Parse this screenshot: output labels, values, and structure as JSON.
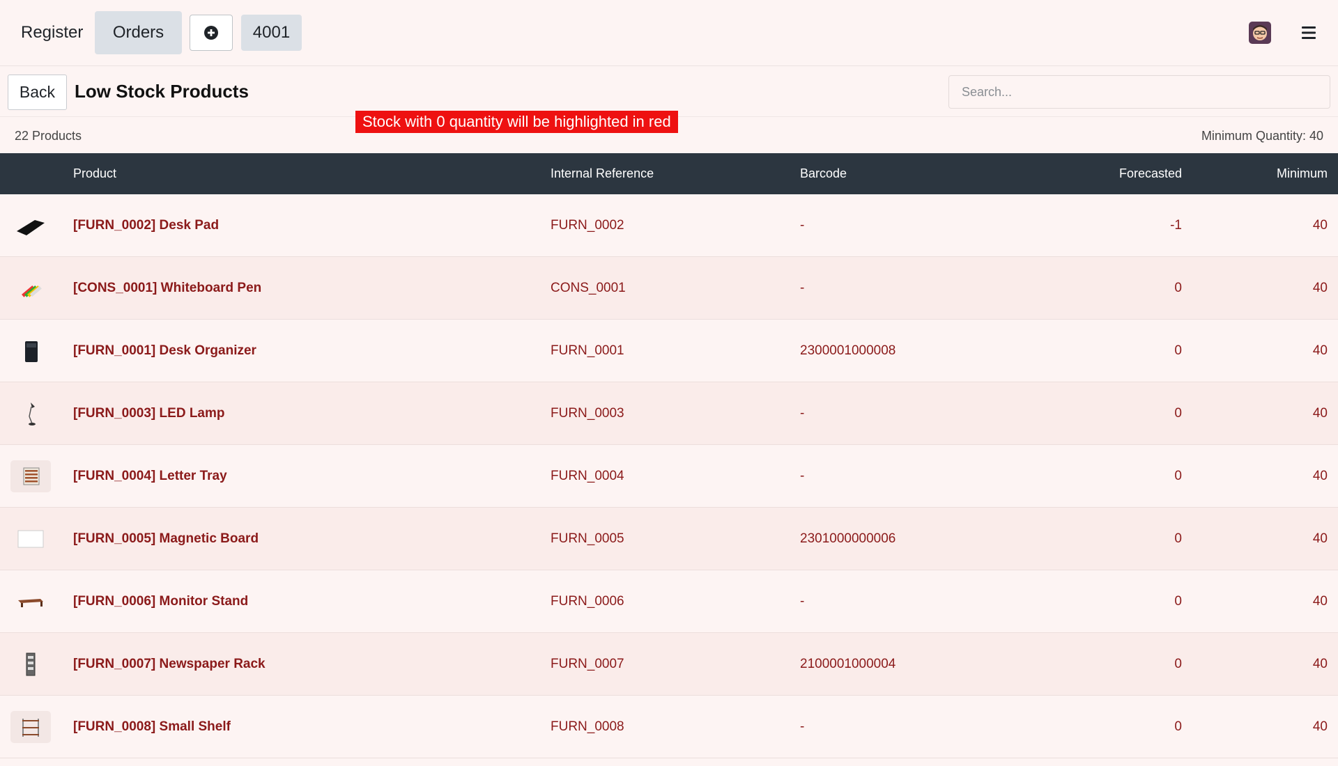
{
  "navbar": {
    "register_label": "Register",
    "orders_label": "Orders",
    "add_icon": "plus-circle-icon",
    "order_number": "4001",
    "avatar_icon": "user-avatar",
    "menu_icon": "hamburger-menu-icon"
  },
  "control_panel": {
    "back_label": "Back",
    "title": "Low Stock Products",
    "search_placeholder": "Search..."
  },
  "notice": "Stock with 0 quantity will be highlighted in red",
  "summary": {
    "product_count": "22 Products",
    "minimum_quantity": "Minimum Quantity: 40"
  },
  "table": {
    "headers": {
      "product": "Product",
      "internal_reference": "Internal Reference",
      "barcode": "Barcode",
      "forecasted": "Forecasted",
      "minimum": "Minimum"
    },
    "rows": [
      {
        "name": "[FURN_0002] Desk Pad",
        "ref": "FURN_0002",
        "barcode": "-",
        "forecasted": "-1",
        "minimum": "40",
        "thumb": "desk-pad"
      },
      {
        "name": "[CONS_0001] Whiteboard Pen",
        "ref": "CONS_0001",
        "barcode": "-",
        "forecasted": "0",
        "minimum": "40",
        "thumb": "whiteboard-pen"
      },
      {
        "name": "[FURN_0001] Desk Organizer",
        "ref": "FURN_0001",
        "barcode": "2300001000008",
        "forecasted": "0",
        "minimum": "40",
        "thumb": "desk-organizer"
      },
      {
        "name": "[FURN_0003] LED Lamp",
        "ref": "FURN_0003",
        "barcode": "-",
        "forecasted": "0",
        "minimum": "40",
        "thumb": "led-lamp"
      },
      {
        "name": "[FURN_0004] Letter Tray",
        "ref": "FURN_0004",
        "barcode": "-",
        "forecasted": "0",
        "minimum": "40",
        "thumb": "letter-tray"
      },
      {
        "name": "[FURN_0005] Magnetic Board",
        "ref": "FURN_0005",
        "barcode": "2301000000006",
        "forecasted": "0",
        "minimum": "40",
        "thumb": "magnetic-board"
      },
      {
        "name": "[FURN_0006] Monitor Stand",
        "ref": "FURN_0006",
        "barcode": "-",
        "forecasted": "0",
        "minimum": "40",
        "thumb": "monitor-stand"
      },
      {
        "name": "[FURN_0007] Newspaper Rack",
        "ref": "FURN_0007",
        "barcode": "2100001000004",
        "forecasted": "0",
        "minimum": "40",
        "thumb": "newspaper-rack"
      },
      {
        "name": "[FURN_0008] Small Shelf",
        "ref": "FURN_0008",
        "barcode": "-",
        "forecasted": "0",
        "minimum": "40",
        "thumb": "small-shelf"
      }
    ]
  },
  "colors": {
    "accent_text": "#8b1a1a",
    "header_bg": "#2c3640",
    "notice_bg": "#ee1111",
    "page_bg": "#fdf4f3"
  }
}
